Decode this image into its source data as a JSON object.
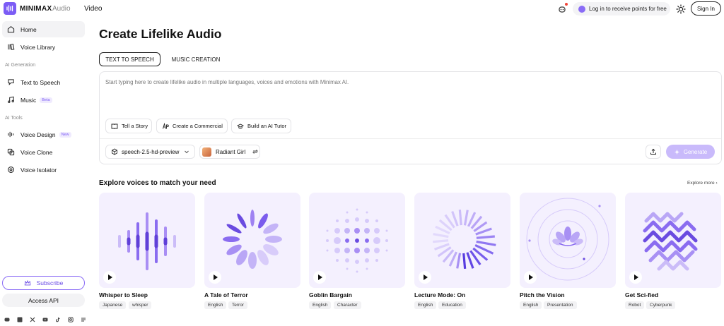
{
  "header": {
    "brand": "MINIMAX",
    "nav_audio": "Audio",
    "nav_video": "Video",
    "login_points": "Log in to receive points for free",
    "signin": "Sign In"
  },
  "sidebar": {
    "items": [
      {
        "label": "Home"
      },
      {
        "label": "Voice Library"
      }
    ],
    "section_ai_generation": "AI Generation",
    "gen_items": [
      {
        "label": "Text to Speech"
      },
      {
        "label": "Music",
        "badge": "Beta"
      }
    ],
    "section_ai_tools": "AI Tools",
    "tool_items": [
      {
        "label": "Voice Design",
        "badge": "New"
      },
      {
        "label": "Voice Clone"
      },
      {
        "label": "Voice Isolator"
      }
    ],
    "subscribe": "Subscribe",
    "access_api": "Access API"
  },
  "main": {
    "title": "Create Lifelike Audio",
    "tabs": [
      {
        "label": "TEXT TO SPEECH"
      },
      {
        "label": "MUSIC CREATION"
      }
    ],
    "editor": {
      "placeholder": "Start typing here to create lifelike audio in multiple languages, voices and emotions with Minimax AI.",
      "suggestions": [
        {
          "label": "Tell a Story"
        },
        {
          "label": "Create a Commercial"
        },
        {
          "label": "Build an AI Tutor"
        }
      ],
      "model": "speech-2.5-hd-preview",
      "voice": "Radiant Girl",
      "generate": "Generate"
    },
    "explore": {
      "heading": "Explore voices to match your need",
      "more": "Explore more",
      "cards": [
        {
          "title": "Whisper to Sleep",
          "tags": [
            "Japanese",
            "whisper"
          ]
        },
        {
          "title": "A Tale of Terror",
          "tags": [
            "English",
            "Terror"
          ]
        },
        {
          "title": "Goblin Bargain",
          "tags": [
            "English",
            "Character"
          ]
        },
        {
          "title": "Lecture Mode: On",
          "tags": [
            "English",
            "Education"
          ]
        },
        {
          "title": "Pitch the Vision",
          "tags": [
            "English",
            "Presentation"
          ]
        },
        {
          "title": "Get Sci-fied",
          "tags": [
            "Robot",
            "Cyberpunk"
          ]
        }
      ]
    }
  },
  "colors": {
    "accent": "#7b5cf5",
    "card_bg": "#f4f0fe",
    "generate_bg": "#c9bafb"
  }
}
